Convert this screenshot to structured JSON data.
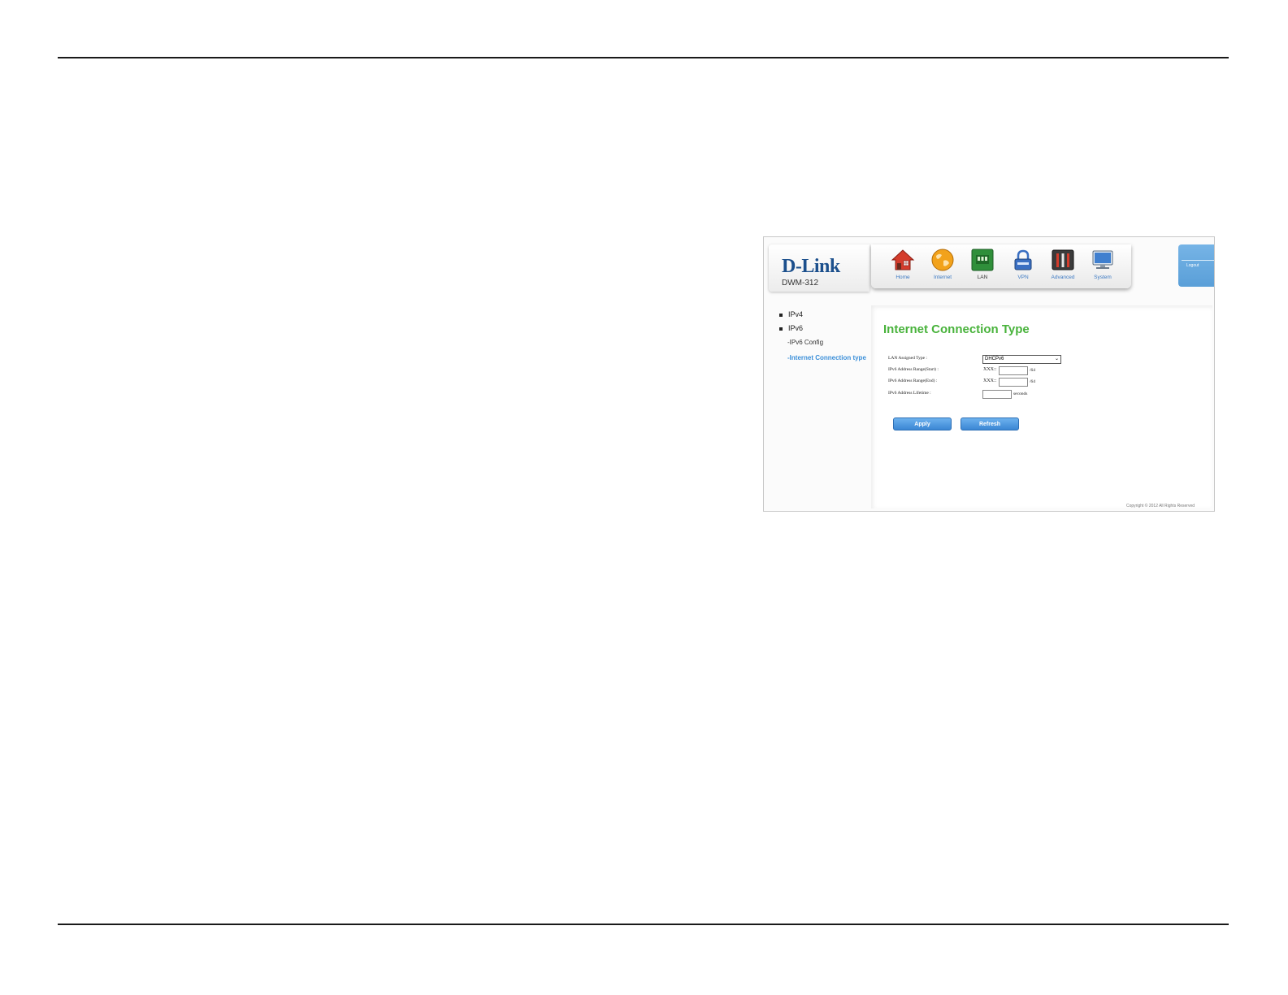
{
  "brand": {
    "logo": "D-Link",
    "model": "DWM-312"
  },
  "nav": [
    {
      "label": "Home",
      "icon": "house-icon"
    },
    {
      "label": "Internet",
      "icon": "globe-icon"
    },
    {
      "label": "LAN",
      "icon": "lan-switch-icon",
      "active": true
    },
    {
      "label": "VPN",
      "icon": "lock-icon"
    },
    {
      "label": "Advanced",
      "icon": "tools-icon"
    },
    {
      "label": "System",
      "icon": "monitor-icon"
    }
  ],
  "logout": {
    "label": "Logout"
  },
  "sidebar": {
    "items": [
      "IPv4",
      "IPv6"
    ],
    "sub_items": [
      "-IPv6 Config",
      "-Internet Connection type"
    ]
  },
  "main": {
    "title": "Internet Connection Type",
    "fields": {
      "lan_type_label": "LAN Assigned Type :",
      "lan_type_value": "DHCPv6",
      "range_start_label": "IPv6 Address Range(Start) :",
      "range_end_label": "IPv6 Address Range(End) :",
      "lifetime_label": "IPv6 Address Lifetime :",
      "prefix": "XXX::",
      "suffix_64": "/64",
      "seconds": "seconds"
    },
    "buttons": {
      "apply": "Apply",
      "refresh": "Refresh"
    }
  },
  "copyright": "Copyright © 2012  All Rights Reserved",
  "colors": {
    "title_green": "#49b33c",
    "link_blue": "#3b8fd9",
    "button_blue": "#3a86d4",
    "brand_blue": "#1b4f8c"
  }
}
